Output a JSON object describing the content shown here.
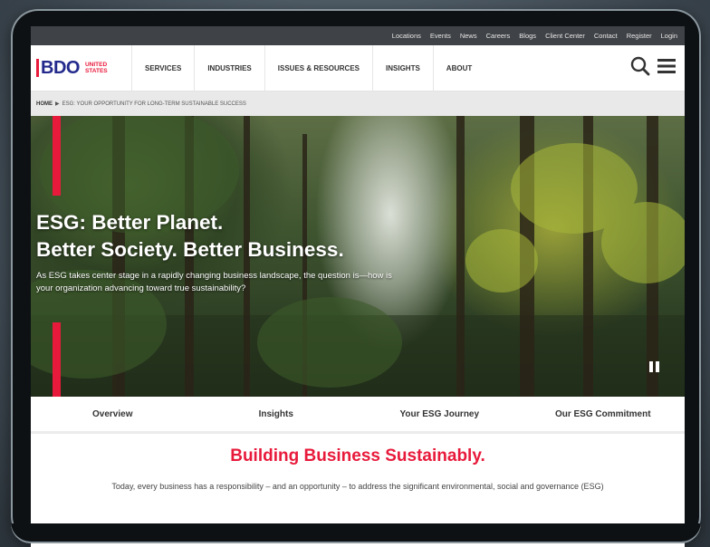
{
  "utility_links": [
    "Locations",
    "Events",
    "News",
    "Careers",
    "Blogs",
    "Client Center",
    "Contact",
    "Register",
    "Login"
  ],
  "logo": {
    "name": "BDO",
    "sub_line1": "UNITED",
    "sub_line2": "STATES"
  },
  "nav": [
    "SERVICES",
    "INDUSTRIES",
    "ISSUES & RESOURCES",
    "INSIGHTS",
    "ABOUT"
  ],
  "icons": {
    "search": "search-icon",
    "menu": "hamburger-menu-icon",
    "pause": "pause-icon"
  },
  "breadcrumb": {
    "home": "HOME",
    "current": "ESG: YOUR OPPORTUNITY FOR LONG-TERM SUSTAINABLE SUCCESS"
  },
  "hero": {
    "title_line1": "ESG: Better Planet.",
    "title_line2": "Better Society. Better Business.",
    "subtitle": "As ESG takes center stage in a rapidly changing business landscape, the question is—how is your organization advancing toward true sustainability?"
  },
  "tabs": [
    "Overview",
    "Insights",
    "Your ESG Journey",
    "Our ESG Commitment"
  ],
  "content": {
    "heading": "Building Business Sustainably.",
    "body": "Today, every business has a responsibility – and an opportunity – to address the significant environmental, social and governance (ESG)"
  },
  "colors": {
    "brand_red": "#e81a3b",
    "brand_blue": "#232a8c",
    "utility_bar": "#3f4246"
  }
}
